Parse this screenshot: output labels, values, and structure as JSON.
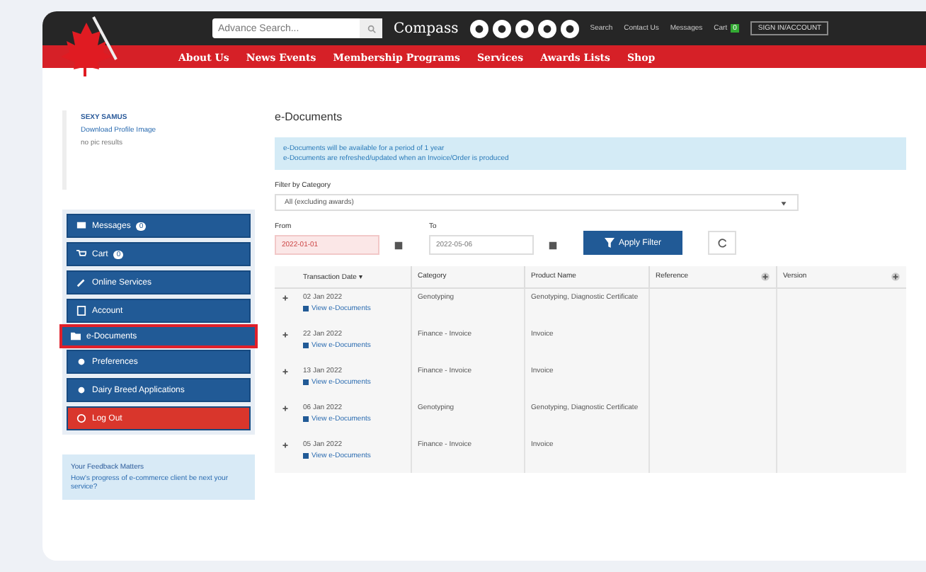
{
  "header": {
    "search": {
      "placeholder": "Advance Search..."
    },
    "brand": "Compass",
    "links": [
      "Search",
      "Contact Us",
      "Messages"
    ],
    "cart": {
      "label": "Cart",
      "count": "0"
    },
    "account_button": "SIGN IN/ACCOUNT"
  },
  "nav": [
    "About Us",
    "News Events",
    "Membership Programs",
    "Services",
    "Awards Lists",
    "Shop"
  ],
  "profile": {
    "name": "SEXY SAMUS",
    "link": "Download Profile Image",
    "note": "no pic results"
  },
  "sidebar": [
    {
      "label": "Messages",
      "badge": "0",
      "kind": "normal",
      "selected": false
    },
    {
      "label": "Cart",
      "badge": "0",
      "kind": "normal",
      "selected": false
    },
    {
      "label": "Online Services",
      "kind": "normal",
      "selected": false
    },
    {
      "label": "Account",
      "kind": "normal",
      "selected": false
    },
    {
      "label": "e-Documents",
      "kind": "normal",
      "selected": true
    },
    {
      "label": "Preferences",
      "kind": "normal",
      "selected": false
    },
    {
      "label": "Dairy Breed Applications",
      "kind": "normal",
      "selected": false
    },
    {
      "label": "Log Out",
      "kind": "danger",
      "selected": false
    }
  ],
  "feedback": {
    "title": "Your Feedback Matters",
    "text": "How's progress of e-commerce client be next your service?"
  },
  "main": {
    "title": "e-Documents",
    "notices": [
      "e-Documents will be available for a period of 1 year",
      "e-Documents are refreshed/updated when an Invoice/Order is produced"
    ],
    "filter": {
      "label": "Filter by Category",
      "value": "All (excluding awards)"
    },
    "from": {
      "label": "From",
      "value": "2022-01-01"
    },
    "to": {
      "label": "To",
      "value": "2022-05-06"
    },
    "apply": "Apply Filter"
  },
  "table": {
    "columns": [
      {
        "label": "Transaction Date ▾",
        "filter": false
      },
      {
        "label": "Category",
        "filter": false
      },
      {
        "label": "Product Name",
        "filter": false
      },
      {
        "label": "Reference",
        "filter": true
      },
      {
        "label": "Version",
        "filter": true
      }
    ],
    "rows": [
      {
        "date": "02 Jan 2022",
        "link": "View e-Documents",
        "category": "Genotyping",
        "product": "Genotyping, Diagnostic Certificate"
      },
      {
        "date": "22 Jan 2022",
        "link": "View e-Documents",
        "category": "Finance - Invoice",
        "product": "Invoice"
      },
      {
        "date": "13 Jan 2022",
        "link": "View e-Documents",
        "category": "Finance - Invoice",
        "product": "Invoice"
      },
      {
        "date": "06 Jan 2022",
        "link": "View e-Documents",
        "category": "Genotyping",
        "product": "Genotyping, Diagnostic Certificate"
      },
      {
        "date": "05 Jan 2022",
        "link": "View e-Documents",
        "category": "Finance - Invoice",
        "product": "Invoice"
      }
    ]
  }
}
